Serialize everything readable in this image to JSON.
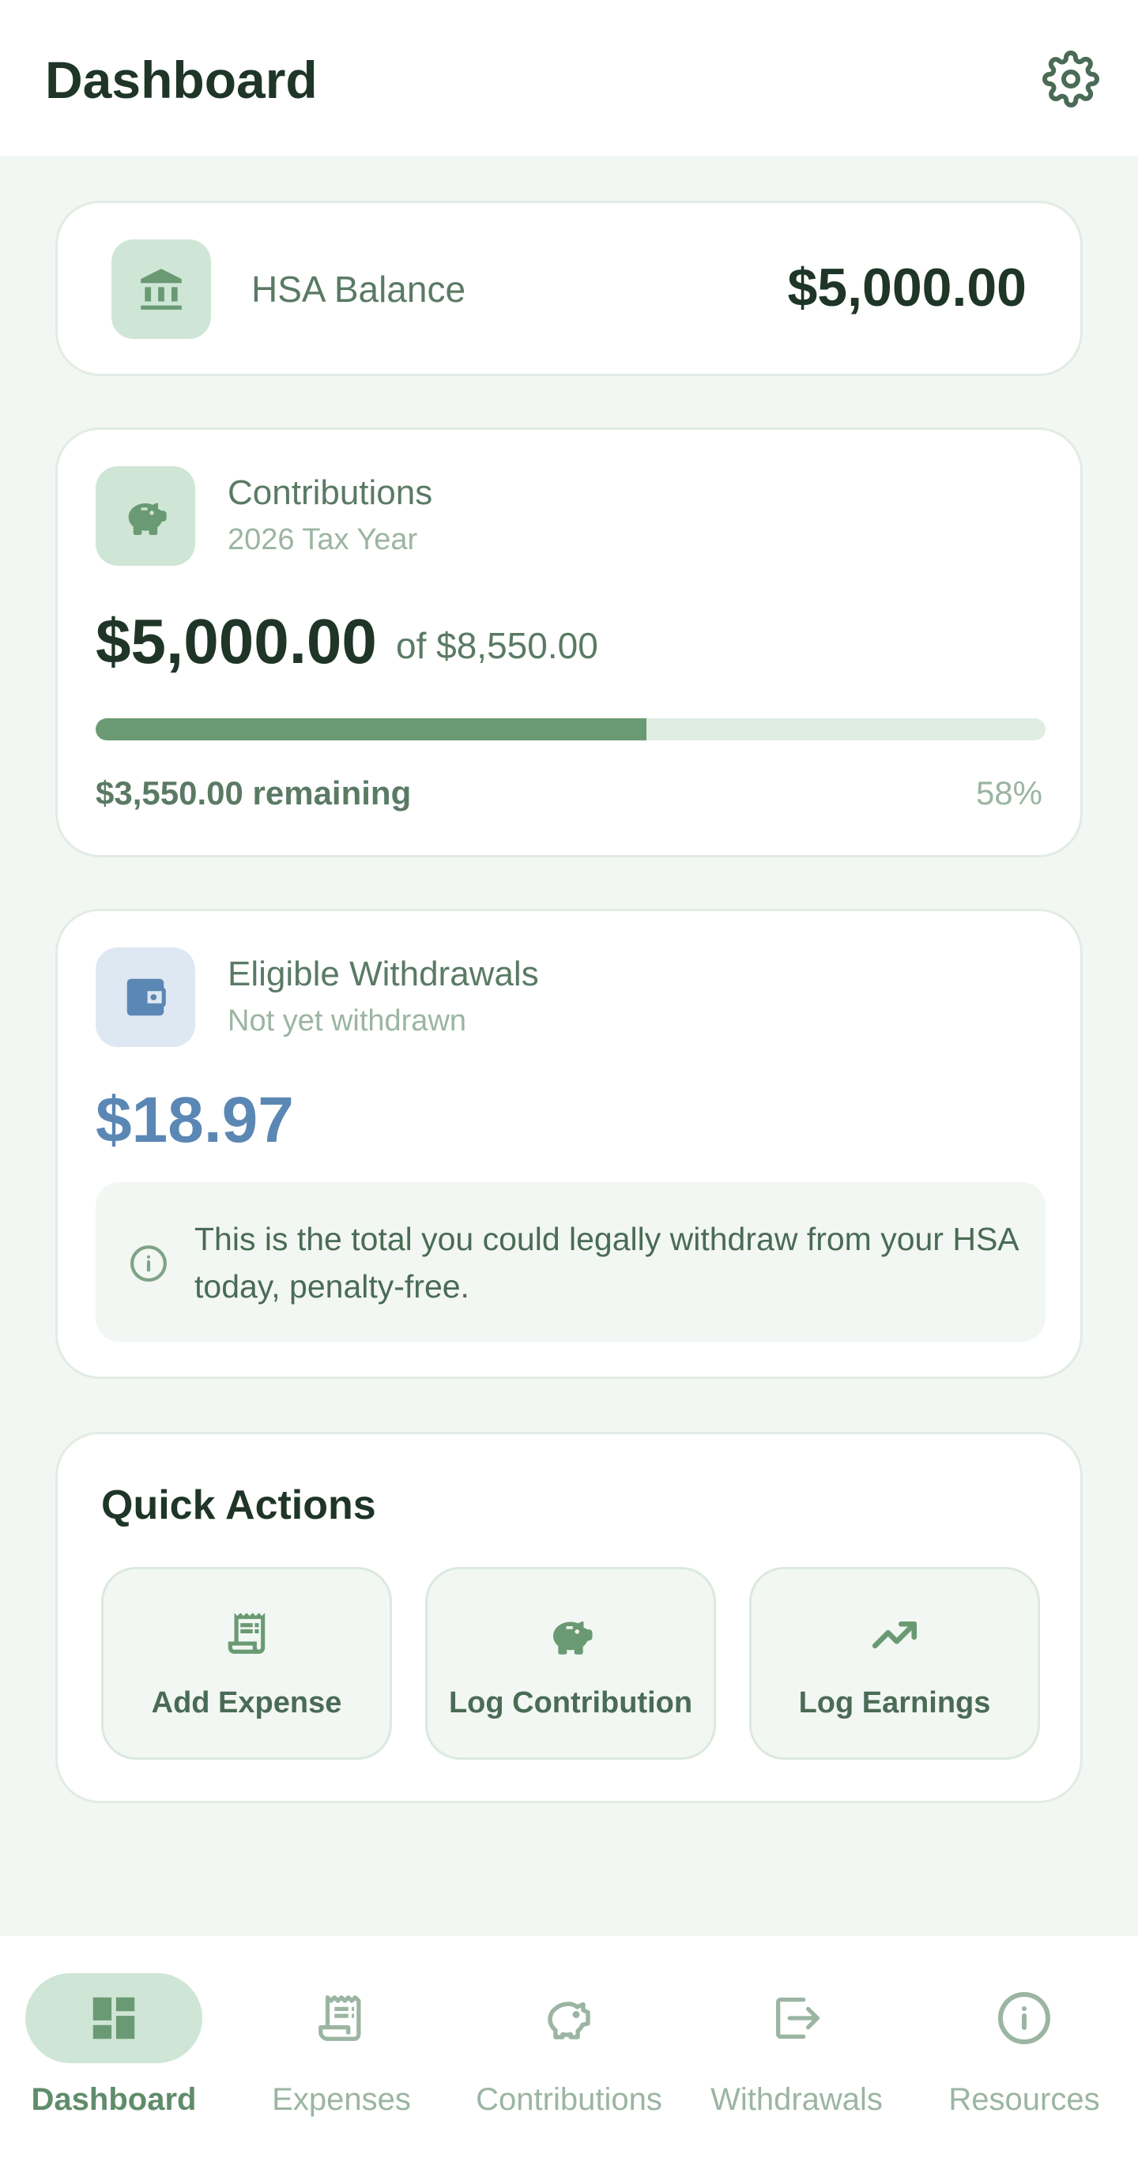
{
  "header": {
    "title": "Dashboard",
    "settings_icon": "gear-icon"
  },
  "balance": {
    "label": "HSA Balance",
    "amount": "$5,000.00",
    "icon": "bank-icon"
  },
  "contributions": {
    "title": "Contributions",
    "subtitle": "2026 Tax Year",
    "amount": "$5,000.00",
    "of_amount": "of $8,550.00",
    "progress_fraction": 0.58,
    "remaining": "$3,550.00 remaining",
    "percent": "58%",
    "icon": "piggy-bank-icon"
  },
  "eligible_withdrawals": {
    "title": "Eligible Withdrawals",
    "subtitle": "Not yet withdrawn",
    "amount": "$18.97",
    "info_text": "This is the total you could legally withdraw from your HSA today, penalty-free.",
    "icon": "wallet-icon"
  },
  "quick_actions": {
    "title": "Quick Actions",
    "buttons": [
      {
        "label": "Add Expense",
        "icon": "receipt-icon"
      },
      {
        "label": "Log Contribution",
        "icon": "piggy-bank-icon"
      },
      {
        "label": "Log Earnings",
        "icon": "trending-up-icon"
      }
    ]
  },
  "bottom_nav": {
    "items": [
      {
        "label": "Dashboard",
        "icon": "dashboard-icon",
        "active": true
      },
      {
        "label": "Expenses",
        "icon": "receipt-icon",
        "active": false
      },
      {
        "label": "Contributions",
        "icon": "piggy-bank-icon",
        "active": false
      },
      {
        "label": "Withdrawals",
        "icon": "exit-icon",
        "active": false
      },
      {
        "label": "Resources",
        "icon": "info-icon",
        "active": false
      }
    ]
  },
  "colors": {
    "primary": "#6a9a73",
    "primary_light": "#cfe6d6",
    "background": "#f2f7f3",
    "accent_blue": "#5b87b4",
    "text_dark": "#1e3527"
  }
}
